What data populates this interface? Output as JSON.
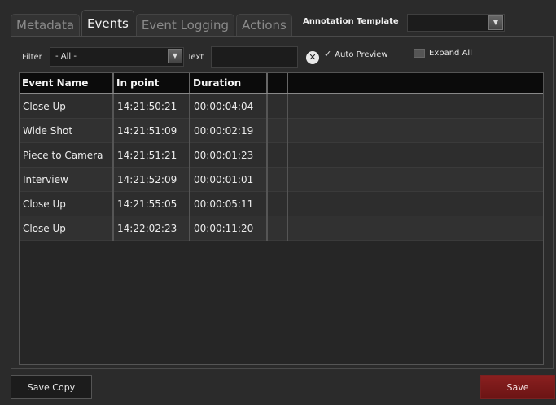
{
  "tabs": [
    {
      "label": "Metadata"
    },
    {
      "label": "Events"
    },
    {
      "label": "Event Logging"
    },
    {
      "label": "Actions"
    }
  ],
  "annotation": {
    "label": "Annotation Template",
    "value": ""
  },
  "filter": {
    "label": "Filter",
    "value": "- All -"
  },
  "text_filter": {
    "label": "Text",
    "value": ""
  },
  "auto_preview": {
    "label": "Auto Preview",
    "checked": true
  },
  "expand_all": {
    "label": "Expand All",
    "checked": false
  },
  "table": {
    "columns": [
      "Event Name",
      "In point",
      "Duration",
      ""
    ],
    "rows": [
      [
        "Close Up",
        "14:21:50:21",
        "00:00:04:04"
      ],
      [
        "Wide Shot",
        "14:21:51:09",
        "00:00:02:19"
      ],
      [
        "Piece to Camera",
        "14:21:51:21",
        "00:00:01:23"
      ],
      [
        "Interview",
        "14:21:52:09",
        "00:00:01:01"
      ],
      [
        "Close Up",
        "14:21:55:05",
        "00:00:05:11"
      ],
      [
        "Close Up",
        "14:22:02:23",
        "00:00:11:20"
      ]
    ]
  },
  "buttons": {
    "save_copy": "Save Copy",
    "save": "Save"
  },
  "colors": {
    "background": "#2b2b2b",
    "save_button": "#7a1a1a",
    "header": "#0b0b0b"
  }
}
